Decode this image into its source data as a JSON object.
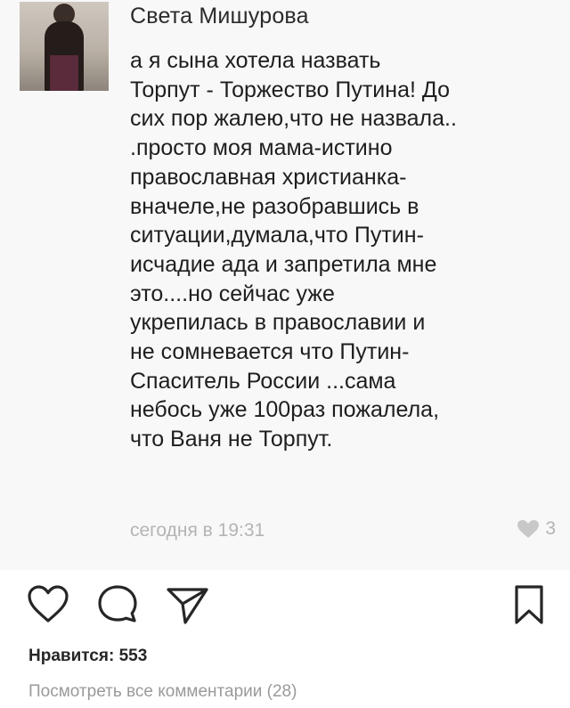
{
  "comment": {
    "author": "Света Мишурова",
    "text": "а я сына хотела назвать\nТорпут - Торжество Путина! До\nсих пор жалею,что не назвала..\n.просто моя мама-истино\nправославная христианка-\nвначеле,не разобравшись в\nситуации,думала,что Путин-\nисчадие ада и запретила мне\nэто....но сейчас уже\nукрепилась в православии и\nне сомневается что Путин-\nСпаситель России ...сама\nнебось уже 100раз пожалела,\nчто Ваня не Торпут.",
    "timestamp": "сегодня в 19:31",
    "like_count": "3",
    "like_icon": "heart-icon"
  },
  "post": {
    "actions": [
      "heart-icon",
      "comment-icon",
      "share-icon",
      "bookmark-icon"
    ],
    "likes_label": "Нравится: 553",
    "view_comments_label": "Посмотреть все комментарии (28)"
  },
  "colors": {
    "text": "#262626",
    "muted": "#9a9a9a",
    "faint": "#b4b4b4"
  }
}
